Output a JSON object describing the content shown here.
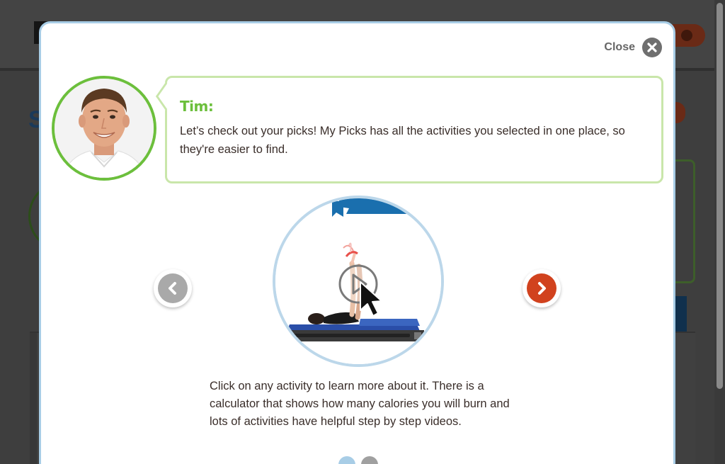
{
  "modal": {
    "close_label": "Close",
    "speaker_name": "Tim:",
    "speech_text": "Let’s check out your picks! My Picks has all the activities you selected in one place, so they're easier to find.",
    "description": "Click on any activity to learn more about it. There is a calculator that shows how many calories you will burn and lots of activities have helpful step by step videos.",
    "pagination": {
      "total": 2,
      "active": 1
    }
  },
  "icons": {
    "close": "close-x-icon",
    "prev": "chevron-left-icon",
    "next": "chevron-right-icon",
    "play": "play-icon",
    "cursor": "mouse-cursor-icon"
  },
  "colors": {
    "accent_green": "#6cbf3c",
    "accent_blue": "#a8cde6",
    "next_red": "#d1421e",
    "text_dark": "#3a2e2a"
  }
}
